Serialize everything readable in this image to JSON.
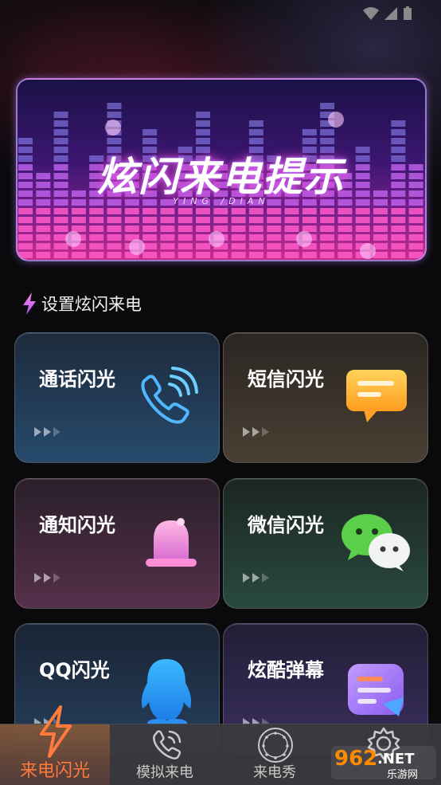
{
  "banner": {
    "title": "炫闪来电提示",
    "subtitle": "YING /DIAN"
  },
  "section": {
    "title": "设置炫闪来电"
  },
  "cards": [
    {
      "label": "通话闪光",
      "icon": "phone-call-icon"
    },
    {
      "label": "短信闪光",
      "icon": "message-bubble-icon"
    },
    {
      "label": "通知闪光",
      "icon": "bell-icon"
    },
    {
      "label": "微信闪光",
      "icon": "wechat-icon"
    },
    {
      "label": "QQ闪光",
      "icon": "qq-penguin-icon"
    },
    {
      "label": "炫酷弹幕",
      "icon": "danmu-icon"
    }
  ],
  "tabs": [
    {
      "label": "来电闪光",
      "icon": "lightning-icon",
      "active": true
    },
    {
      "label": "模拟来电",
      "icon": "phone-icon",
      "active": false
    },
    {
      "label": "来电秀",
      "icon": "dial-icon",
      "active": false
    },
    {
      "label": "",
      "icon": "gear-icon",
      "active": false
    }
  ],
  "watermark": {
    "text": "962.NET",
    "subtext": "乐游网"
  },
  "colors": {
    "accent": "#ff7a3c",
    "banner_glow": "#ff3fc2"
  }
}
